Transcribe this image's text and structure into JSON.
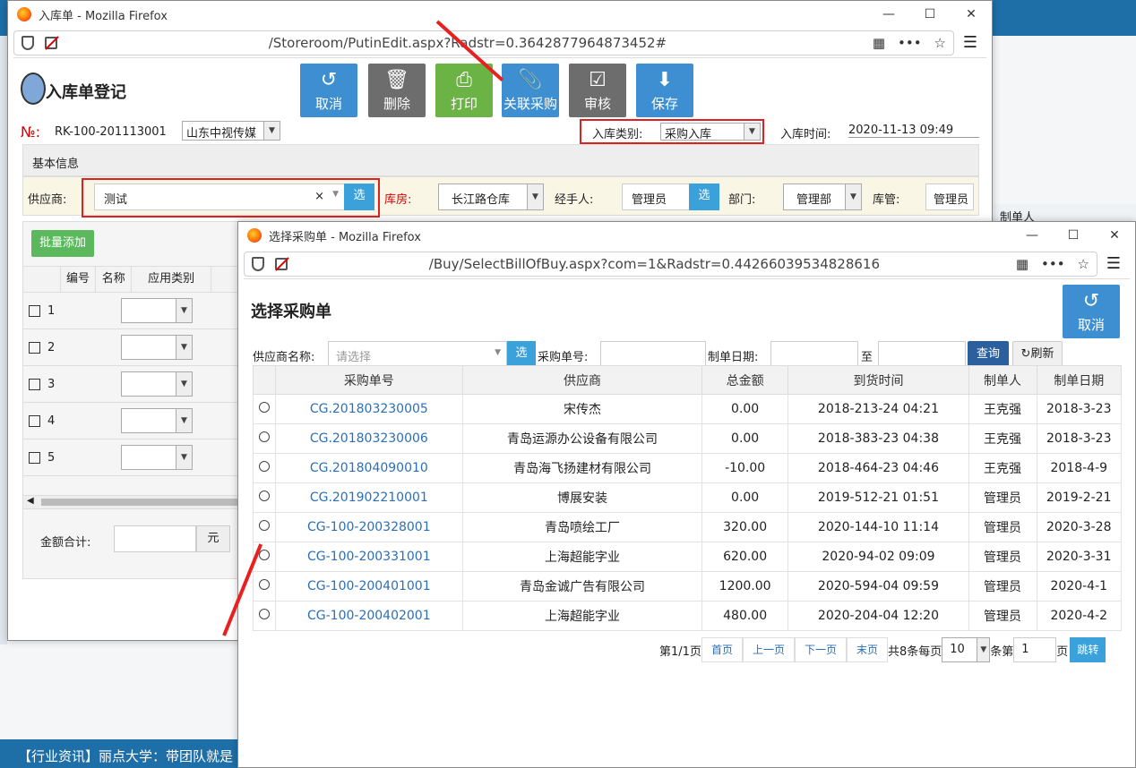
{
  "background": {
    "header_col": "制单人",
    "footer_text": "【行业资讯】丽点大学：带团队就是"
  },
  "main_window": {
    "title": "入库单 - Mozilla Firefox",
    "url": "/Storeroom/PutinEdit.aspx?Radstr=0.3642877964873452#",
    "page_title": "入库单登记",
    "toolbar": {
      "cancel": "取消",
      "delete": "删除",
      "print": "打印",
      "link_po": "关联采购",
      "audit": "审核",
      "save": "保存"
    },
    "no_label": "№:",
    "no_value": "RK-100-201113001",
    "company": "山东中视传媒",
    "type_label": "入库类别:",
    "type_value": "采购入库",
    "time_label": "入库时间:",
    "time_value": "2020-11-13 09:49",
    "section_title": "基本信息",
    "supplier_label": "供应商:",
    "supplier_value": "测试",
    "select_btn": "选",
    "warehouse_label": "库房:",
    "warehouse_value": "长江路仓库",
    "handler_label": "经手人:",
    "handler_value": "管理员",
    "dept_label": "部门:",
    "dept_value": "管理部",
    "keeper_label": "库管:",
    "keeper_value": "管理员",
    "batch_add": "批量添加",
    "grid_headers": [
      "编号",
      "名称",
      "应用类别"
    ],
    "grid_rows": [
      "1",
      "2",
      "3",
      "4",
      "5"
    ],
    "total_label": "金额合计:",
    "total_unit": "元"
  },
  "dialog": {
    "title": "选择采购单 - Mozilla Firefox",
    "url": "/Buy/SelectBillOfBuy.aspx?com=1&Radstr=0.44266039534828616",
    "heading": "选择采购单",
    "cancel": "取消",
    "supplier_label": "供应商名称:",
    "supplier_placeholder": "请选择",
    "select_btn": "选",
    "po_no_label": "采购单号:",
    "date_label": "制单日期:",
    "date_to": "至",
    "query": "查询",
    "refresh": "刷新",
    "columns": [
      "采购单号",
      "供应商",
      "总金额",
      "到货时间",
      "制单人",
      "制单日期"
    ],
    "rows": [
      [
        "CG.201803230005",
        "宋传杰",
        "0.00",
        "2018-213-24 04:21",
        "王克强",
        "2018-3-23"
      ],
      [
        "CG.201803230006",
        "青岛运源办公设备有限公司",
        "0.00",
        "2018-383-23 04:38",
        "王克强",
        "2018-3-23"
      ],
      [
        "CG.201804090010",
        "青岛海飞扬建材有限公司",
        "-10.00",
        "2018-464-23 04:46",
        "王克强",
        "2018-4-9"
      ],
      [
        "CG.201902210001",
        "博展安装",
        "0.00",
        "2019-512-21 01:51",
        "管理员",
        "2019-2-21"
      ],
      [
        "CG-100-200328001",
        "青岛喷绘工厂",
        "320.00",
        "2020-144-10 11:14",
        "管理员",
        "2020-3-28"
      ],
      [
        "CG-100-200331001",
        "上海超能字业",
        "620.00",
        "2020-94-02 09:09",
        "管理员",
        "2020-3-31"
      ],
      [
        "CG-100-200401001",
        "青岛金诚广告有限公司",
        "1200.00",
        "2020-594-04 09:59",
        "管理员",
        "2020-4-1"
      ],
      [
        "CG-100-200402001",
        "上海超能字业",
        "480.00",
        "2020-204-04 12:20",
        "管理员",
        "2020-4-2"
      ]
    ],
    "pager": {
      "page_info": "第1/1页",
      "first": "首页",
      "prev": "上一页",
      "next": "下一页",
      "last": "末页",
      "total": "共8条每页",
      "per_page": "10",
      "goto_prefix": "条第",
      "goto_value": "1",
      "goto_suffix": "页",
      "jump": "跳转"
    }
  }
}
